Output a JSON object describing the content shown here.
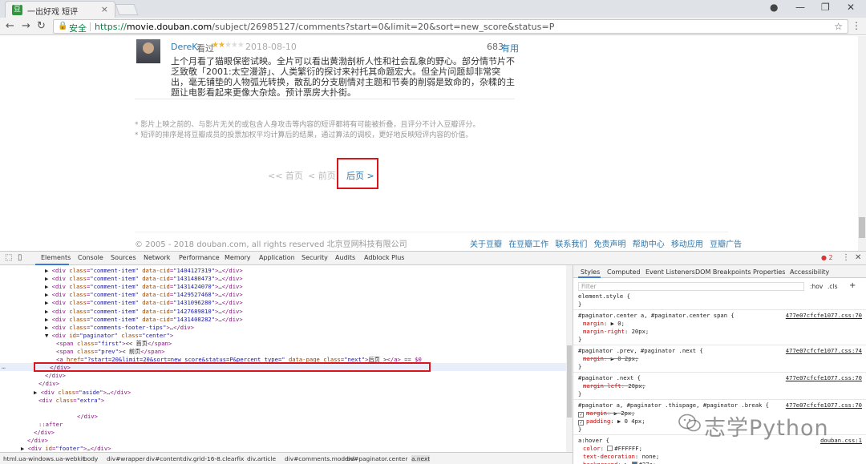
{
  "browser": {
    "tab_title": "一出好戏 短评",
    "favicon_letter": "豆",
    "tab_close": "×",
    "url_secure_label": "安全",
    "url_scheme": "https://",
    "url_host": "movie.douban.com",
    "url_path": "/subject/26985127/comments?start=0&limit=20&sort=new_score&status=P"
  },
  "comment": {
    "author": "DereK",
    "watched_label": "看过",
    "stars_filled": "★★",
    "stars_empty": "★★★",
    "date": "2018-08-10",
    "votes": "683",
    "useful_label": "有用",
    "text": "上个月看了猫眼保密试映。全片可以看出黄渤剖析人性和社会乱象的野心。部分情节片不乏致敬「2001:太空漫游」、人类繁衍的探讨来衬托其命题宏大。但全片问题却非常突出，毫无铺垫的人物弧光转换，散乱的分支剧情对主题和节奏的削弱是致命的，杂糅的主题让电影看起来更像大杂烩。预计票房大扑街。"
  },
  "tips": [
    "* 影片上映之前的、与影片无关的或包含人身攻击等内容的短评都将有可能被折叠，且评分不计入豆瓣评分。",
    "* 短评的排序是将豆瓣成员的投票加权平均计算后的结果，通过算法的调校，更好地反映短评内容的价值。"
  ],
  "paginator": {
    "first": "<< 首页",
    "prev": "< 前页",
    "next": "后页 >"
  },
  "footer": {
    "copyright": "© 2005 - 2018 douban.com, all rights reserved 北京豆网科技有限公司",
    "links": [
      "关于豆瓣",
      "在豆瓣工作",
      "联系我们",
      "免责声明",
      "帮助中心",
      "移动应用",
      "豆瓣广告"
    ]
  },
  "devtools": {
    "tabs": [
      "Elements",
      "Console",
      "Sources",
      "Network",
      "Performance",
      "Memory",
      "Application",
      "Security",
      "Audits",
      "Adblock Plus"
    ],
    "error_count": "2",
    "dom_lines": [
      {
        "indent": 56,
        "arrow": "▶",
        "tag": "div",
        "attrs": [
          [
            "class",
            "comment-item"
          ],
          [
            "data-cid",
            "1404127319"
          ]
        ],
        "tail": ">…</div>"
      },
      {
        "indent": 56,
        "arrow": "▶",
        "tag": "div",
        "attrs": [
          [
            "class",
            "comment-item"
          ],
          [
            "data-cid",
            "1431480473"
          ]
        ],
        "tail": ">…</div>"
      },
      {
        "indent": 56,
        "arrow": "▶",
        "tag": "div",
        "attrs": [
          [
            "class",
            "comment-item"
          ],
          [
            "data-cid",
            "1431424070"
          ]
        ],
        "tail": ">…</div>"
      },
      {
        "indent": 56,
        "arrow": "▶",
        "tag": "div",
        "attrs": [
          [
            "class",
            "comment-item"
          ],
          [
            "data-cid",
            "1429527468"
          ]
        ],
        "tail": ">…</div>"
      },
      {
        "indent": 56,
        "arrow": "▶",
        "tag": "div",
        "attrs": [
          [
            "class",
            "comment-item"
          ],
          [
            "data-cid",
            "1431096280"
          ]
        ],
        "tail": ">…</div>"
      },
      {
        "indent": 56,
        "arrow": "▶",
        "tag": "div",
        "attrs": [
          [
            "class",
            "comment-item"
          ],
          [
            "data-cid",
            "1427689810"
          ]
        ],
        "tail": ">…</div>"
      },
      {
        "indent": 56,
        "arrow": "▶",
        "tag": "div",
        "attrs": [
          [
            "class",
            "comment-item"
          ],
          [
            "data-cid",
            "1431408282"
          ]
        ],
        "tail": ">…</div>"
      },
      {
        "indent": 56,
        "arrow": "▶",
        "tag": "div",
        "attrs": [
          [
            "class",
            "comments-footer-tips"
          ]
        ],
        "tail": ">…</div>"
      },
      {
        "indent": 56,
        "arrow": "▼",
        "tag": "div",
        "attrs": [
          [
            "id",
            "paginator"
          ],
          [
            "class",
            "center"
          ]
        ],
        "tail": ">"
      },
      {
        "indent": 70,
        "arrow": "",
        "tag": "span",
        "attrs": [
          [
            "class",
            "first"
          ]
        ],
        "tail": "><< 首页</span>"
      },
      {
        "indent": 70,
        "arrow": "",
        "tag": "span",
        "attrs": [
          [
            "class",
            "prev"
          ]
        ],
        "tail": ">< 前页</span>"
      },
      {
        "indent": 70,
        "arrow": "",
        "tag": "a",
        "attrs": [
          [
            "href",
            "?start=20&limit=20&sort=new_score&status=P&percent_type="
          ],
          [
            "data-page",
            ""
          ],
          [
            "class",
            "next"
          ]
        ],
        "tail": ">后页 ></a> == $0"
      },
      {
        "indent": 62,
        "arrow": "",
        "tag": "",
        "attrs": [],
        "tail": "</div>"
      },
      {
        "indent": 56,
        "arrow": "",
        "tag": "",
        "attrs": [],
        "tail": "</div>"
      },
      {
        "indent": 48,
        "arrow": "",
        "tag": "",
        "attrs": [],
        "tail": "</div>"
      },
      {
        "indent": 42,
        "arrow": "▶",
        "tag": "div",
        "attrs": [
          [
            "class",
            "aside"
          ]
        ],
        "tail": ">…</div>"
      },
      {
        "indent": 48,
        "arrow": "",
        "tag": "div",
        "attrs": [
          [
            "class",
            "extra"
          ]
        ],
        "tail": ">"
      },
      {
        "indent": 48,
        "arrow": "",
        "tag": "",
        "attrs": [],
        "tail": ""
      },
      {
        "indent": 96,
        "arrow": "",
        "tag": "",
        "attrs": [],
        "tail": "</div>"
      },
      {
        "indent": 48,
        "arrow": "",
        "tag": "",
        "attrs": [],
        "tail": "::after"
      },
      {
        "indent": 42,
        "arrow": "",
        "tag": "",
        "attrs": [],
        "tail": "</div>"
      },
      {
        "indent": 34,
        "arrow": "",
        "tag": "",
        "attrs": [],
        "tail": "</div>"
      },
      {
        "indent": 26,
        "arrow": "▶",
        "tag": "div",
        "attrs": [
          [
            "id",
            "footer"
          ]
        ],
        "tail": ">…</div>"
      },
      {
        "indent": 26,
        "arrow": "",
        "tag": "",
        "attrs": [],
        "tail": "<!--"
      }
    ],
    "breadcrumbs": [
      "html.ua-windows.ua-webkit",
      "body",
      "div#wrapper",
      "div#content",
      "div.grid-16-8.clearfix",
      "div.article",
      "div#comments.mod-bd",
      "div#paginator.center",
      "a.next"
    ],
    "style_tabs": [
      "Styles",
      "Computed",
      "Event Listeners",
      "DOM Breakpoints",
      "Properties",
      "Accessibility"
    ],
    "filter_placeholder": "Filter",
    "hov": ":hov",
    "cls": ".cls",
    "plus": "+",
    "rules": [
      {
        "selector": "element.style {",
        "source": "",
        "props": []
      },
      {
        "selector": "#paginator.center a, #paginator.center span {",
        "source": "477e07cfcfe1077.css:70",
        "props": [
          [
            "margin",
            "▶ 0;",
            false,
            false
          ],
          [
            "margin-right",
            "20px;",
            false,
            false
          ]
        ]
      },
      {
        "selector": "#paginator .prev, #paginator .next {",
        "source": "477e07cfcfe1077.css:74",
        "props": [
          [
            "margin",
            "▶ 0 2px;",
            true,
            false
          ]
        ]
      },
      {
        "selector": "#paginator .next {",
        "source": "477e07cfcfe1077.css:70",
        "props": [
          [
            "margin-left",
            "20px;",
            true,
            false
          ]
        ]
      },
      {
        "selector": "#paginator a, #paginator .thispage, #paginator .break {",
        "source": "477e07cfcfe1077.css:70",
        "props": [
          [
            "margin",
            "▶ 2px;",
            true,
            true
          ],
          [
            "padding",
            "▶ 0 4px;",
            false,
            true
          ]
        ]
      },
      {
        "selector": "a:hover {",
        "source": "douban.css:1",
        "props": [
          [
            "color",
            "#FFFFFF;",
            false,
            false
          ],
          [
            "text-decoration",
            "none;",
            false,
            false
          ],
          [
            "background",
            "▶ #37a;",
            false,
            false
          ]
        ]
      }
    ],
    "colors": {
      "link": "#37a",
      "highlight": "#d9161c"
    }
  },
  "watermark": "志学Python"
}
